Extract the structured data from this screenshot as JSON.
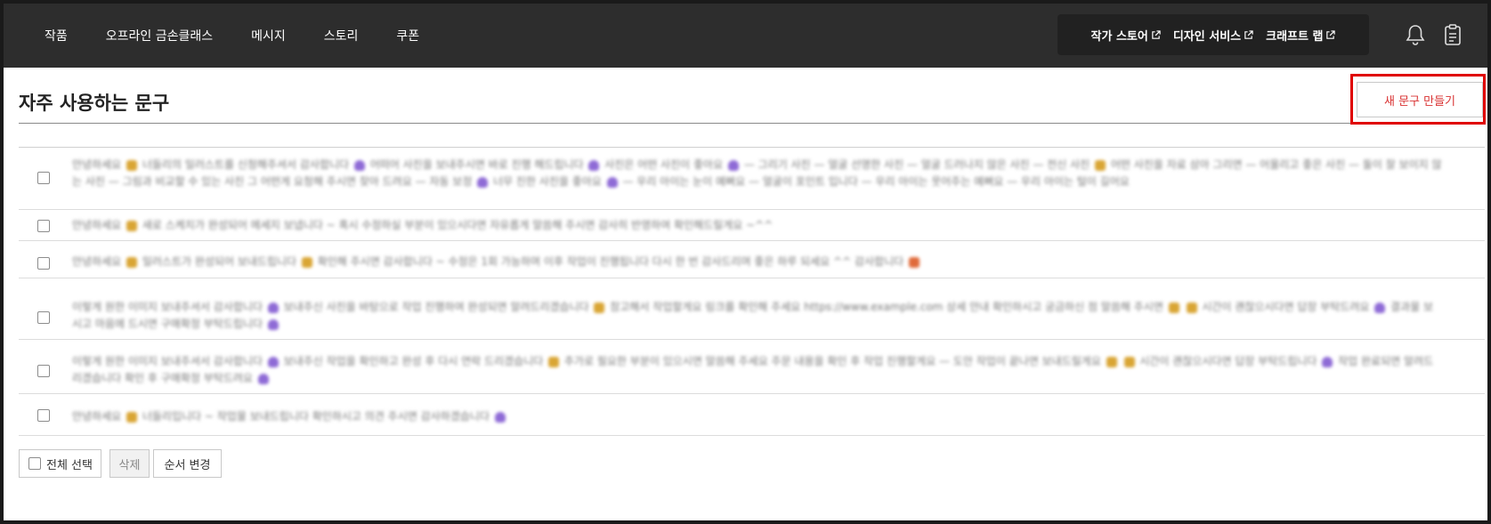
{
  "nav": {
    "items": [
      "작품",
      "오프라인 금손클래스",
      "메시지",
      "스토리",
      "쿠폰"
    ],
    "store_links": [
      "작가 스토어",
      "디자인 서비스",
      "크래프트 랩"
    ]
  },
  "page": {
    "title": "자주 사용하는 문구",
    "new_button": "새 문구 만들기"
  },
  "phrases": [
    "안녕하세요 [y] 너들리의 일러스트를 신청해주셔서 감사합니다 [p] 어떠어 사진을 보내주시면 바로 진행 해드립니다 [p] 사진은 어떤 사진이 좋아요 [p] — 그리기 사진 — 얼굴 선명한 사진 — 얼굴 드러나지 않은 사진 — 전신 사진 [y] 어떤 사진을 자료 삼아 그리면 — 어울리고 좋은 사진 — 둘이 잘 보이지 않는 사진 — 그림과 비교할 수 있는 사진 그 어떤게 요청해 주시면 찾아 드려요 — 자동 보정 [p] 너무 진한 사진을 좋아요 [p] — 우리 아이는 눈이 예뻐요 — 얼굴이 포인트 입니다 — 우리 아이는 웃어주는 예뻐요 — 우리 아이는 털이 길어요",
    "안녕하세요 [y] 새로 스케치가 완성되어 메세지 보냅니다 ~ 혹시 수정하실 부분이 있으시다면 자유롭게 말씀해 주시면 감사히 반영하여 확인해드릴게요 ~^^",
    "안녕하세요 [y] 일러스트가 완성되어 보내드립니다 [y] 확인해 주시면 감사합니다 ~ 수정은 1회 가능하며 이후 작업이 진행됩니다 다시 한 번 감사드리며 좋은 하루 되세요 ^^ 감사합니다 [o]",
    "이렇게 원한 이미지 보내주셔서 감사합니다 [p] 보내주신 사진을 바탕으로 작업 진행하여 완성되면 알려드리겠습니다 [y] 참고해서 작업할게요 링크를 확인해 주세요 https://www.example.com 상세 안내 확인하시고 궁금하신 점 말씀해 주시면 [y] [y] 시간이 괜찮으시다면 답장 부탁드려요 [p] 결과물 보시고 마음에 드시면 구매확정 부탁드립니다 [p]",
    "이렇게 원한 이미지 보내주셔서 감사합니다 [p] 보내주신 작업을 확인하고 완성 후 다시 연락 드리겠습니다 [y] 추가로 필요한 부분이 있으시면 말씀해 주세요 주문 내용을 확인 후 작업 진행할게요 — 도안 작업이 끝나면 보내드릴게요 [y] [y] 시간이 괜찮으시다면 답장 부탁드립니다 [p] 작업 완료되면 알려드리겠습니다 확인 후 구매확정 부탁드려요 [p]",
    "안녕하세요 [y] 너들리입니다 ~ 작업물 보내드립니다 확인하시고 의견 주시면 감사하겠습니다 [p]"
  ],
  "footer": {
    "select_all": "전체 선택",
    "delete": "삭제",
    "reorder": "순서 변경"
  },
  "colors": {
    "nav_bg": "#2d2d2d",
    "accent": "#d93232",
    "highlight": "#e00000"
  }
}
